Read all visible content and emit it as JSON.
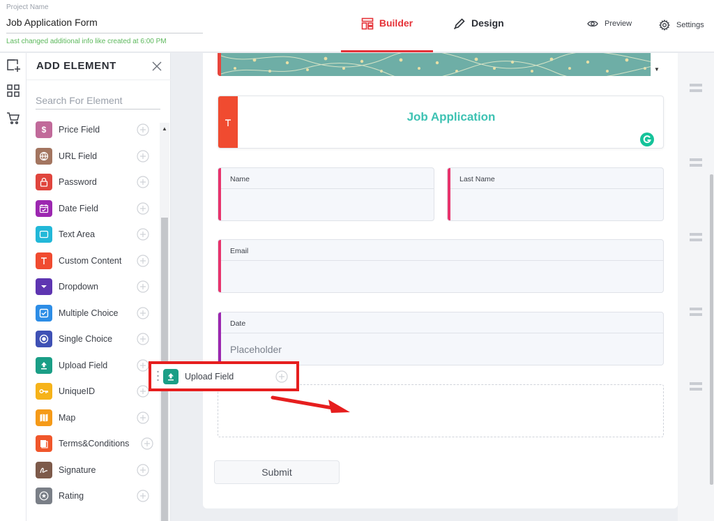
{
  "header": {
    "project_label": "Project Name",
    "project_name": "Job Application Form",
    "last_changed": "Last changed additional info like created at 6:00 PM",
    "tabs": [
      {
        "label": "Builder",
        "icon": "builder-icon",
        "active": true
      },
      {
        "label": "Design",
        "icon": "pen-icon",
        "active": false
      }
    ],
    "preview_label": "Preview",
    "settings_label": "Settings"
  },
  "rail": {
    "icons": [
      "add-element-icon",
      "grid-icon",
      "cart-icon"
    ]
  },
  "panel": {
    "title": "ADD ELEMENT",
    "search_placeholder": "Search For Element",
    "items": [
      {
        "label": "Price Field",
        "color": "#c16a9a",
        "icon": "dollar-icon"
      },
      {
        "label": "URL Field",
        "color": "#a37560",
        "icon": "globe-icon"
      },
      {
        "label": "Password",
        "color": "#e0453d",
        "icon": "lock-icon"
      },
      {
        "label": "Date Field",
        "color": "#9c27b0",
        "icon": "calendar-icon"
      },
      {
        "label": "Text Area",
        "color": "#22b8d8",
        "icon": "textarea-icon"
      },
      {
        "label": "Custom Content",
        "color": "#f04b30",
        "icon": "text-icon"
      },
      {
        "label": "Dropdown",
        "color": "#5e35b1",
        "icon": "dropdown-icon"
      },
      {
        "label": "Multiple Choice",
        "color": "#2d8de6",
        "icon": "checkbox-icon"
      },
      {
        "label": "Single Choice",
        "color": "#3f51b5",
        "icon": "radio-icon"
      },
      {
        "label": "Upload Field",
        "color": "#1a9e86",
        "icon": "upload-icon"
      },
      {
        "label": "UniqueID",
        "color": "#f6b31a",
        "icon": "key-icon"
      },
      {
        "label": "Map",
        "color": "#f59a18",
        "icon": "map-icon"
      },
      {
        "label": "Terms&Conditions",
        "color": "#f0562b",
        "icon": "document-icon"
      },
      {
        "label": "Signature",
        "color": "#7d5a4a",
        "icon": "signature-icon"
      },
      {
        "label": "Rating",
        "color": "#7a7f87",
        "icon": "star-icon"
      }
    ]
  },
  "form": {
    "title": "Job Application",
    "fields": [
      {
        "label": "Name",
        "accent": "#e8336c",
        "placeholder": ""
      },
      {
        "label": "Last Name",
        "accent": "#e8336c",
        "placeholder": ""
      },
      {
        "label": "Email",
        "accent": "#e8336c",
        "placeholder": ""
      },
      {
        "label": "Date",
        "accent": "#9c27b0",
        "placeholder": "Placeholder"
      }
    ],
    "submit_label": "Submit"
  },
  "drag": {
    "label": "Upload Field",
    "icon": "upload-icon",
    "highlight": "#e61e1e"
  },
  "colors": {
    "accent_red": "#e53238",
    "teal": "#3ec2b3",
    "banner": "#6eaea6"
  }
}
